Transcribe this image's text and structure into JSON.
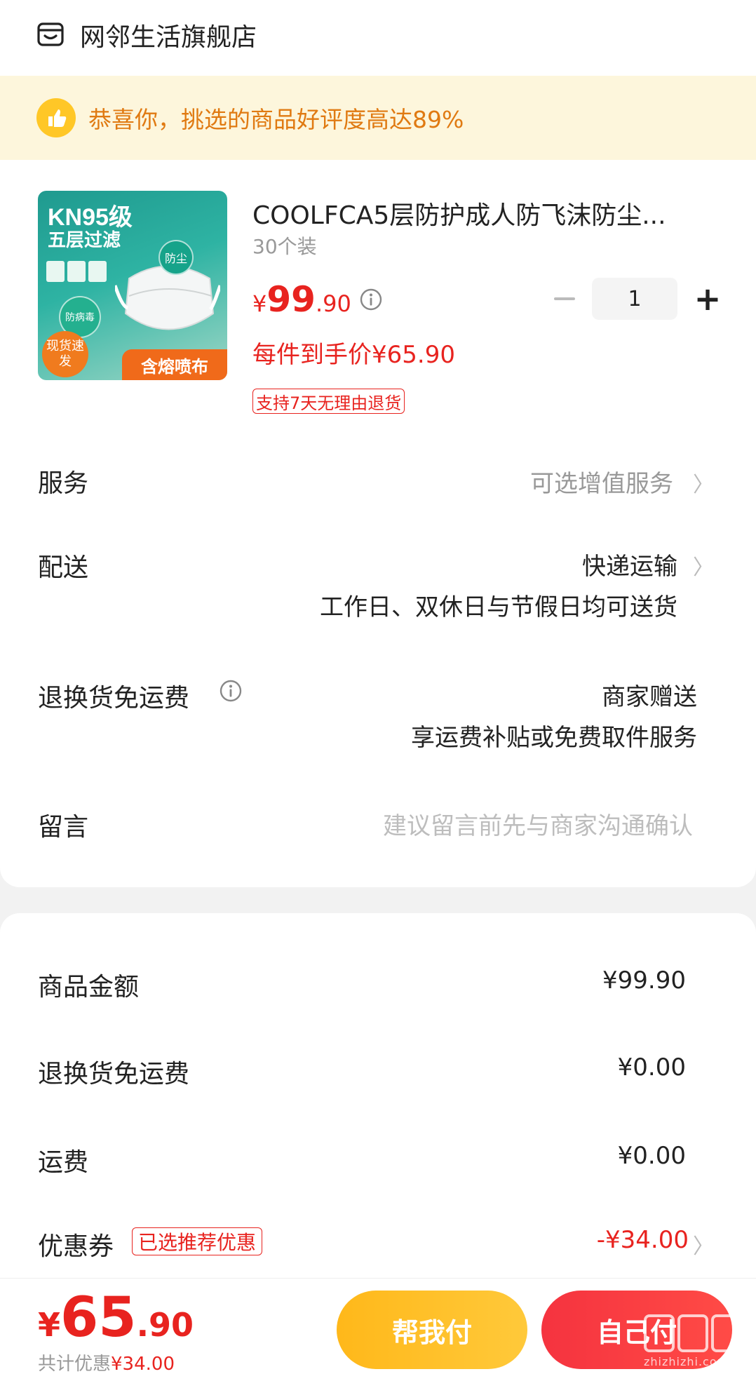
{
  "store": {
    "name": "网邻生活旗舰店",
    "icon": "store-icon"
  },
  "banner": {
    "text": "恭喜你，挑选的商品好评度高达89%",
    "icon": "thumbs-up-icon"
  },
  "product": {
    "image": {
      "title": "KN95级",
      "subtitle": "五层过滤",
      "badge_dust": "防尘",
      "badge_virus": "防病毒",
      "stock": "现货速发",
      "bottom": "含熔喷布"
    },
    "title": "COOLFCA5层防护成人防飞沫防尘...",
    "spec": "30个装",
    "price_currency": "¥",
    "price_int": "99",
    "price_dec": ".90",
    "final_price": "每件到手价¥65.90",
    "return_tag": "支持7天无理由退货",
    "quantity": "1"
  },
  "rows": {
    "service": {
      "label": "服务",
      "value": "可选增值服务"
    },
    "delivery": {
      "label": "配送",
      "value": "快递运输",
      "note": "工作日、双休日与节假日均可送货"
    },
    "return_shipping": {
      "label": "退换货免运费",
      "value": "商家赠送",
      "note": "享运费补贴或免费取件服务"
    },
    "message": {
      "label": "留言",
      "placeholder": "建议留言前先与商家沟通确认"
    }
  },
  "summary": {
    "goods_amount": {
      "label": "商品金额",
      "value": "¥99.90"
    },
    "return_fee": {
      "label": "退换货免运费",
      "value": "¥0.00"
    },
    "shipping": {
      "label": "运费",
      "value": "¥0.00"
    },
    "coupon": {
      "label": "优惠券",
      "tag": "已选推荐优惠",
      "value": "-¥34.00"
    }
  },
  "bottom": {
    "total_currency": "¥",
    "total_int": "65",
    "total_dec": ".90",
    "saved_label": "共计优惠",
    "saved_amount": "¥34.00",
    "help_pay": "帮我付",
    "self_pay": "自己付"
  },
  "watermark": {
    "text": "zhizhizhi.com"
  },
  "colors": {
    "accent": "#e8231f",
    "warning": "#e07a12",
    "help_button": "#ffb81a"
  }
}
